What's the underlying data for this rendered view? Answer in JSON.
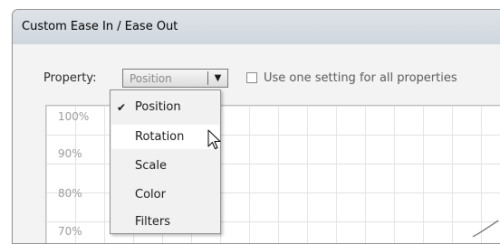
{
  "window": {
    "title": "Custom Ease In / Ease Out"
  },
  "controls": {
    "property_label": "Property:",
    "property_value": "Position",
    "checkbox_label": "Use one setting for all properties"
  },
  "graph": {
    "y_labels": [
      "100%",
      "90%",
      "80%",
      "70%"
    ]
  },
  "dropdown": {
    "items": [
      {
        "label": "Position",
        "checked": true
      },
      {
        "label": "Rotation",
        "checked": false
      },
      {
        "label": "Scale",
        "checked": false
      },
      {
        "label": "Color",
        "checked": false
      },
      {
        "label": "Filters",
        "checked": false
      }
    ],
    "check_glyph": "✔",
    "hovered_item": "Rotation"
  },
  "icons": {
    "select_arrow": "chevron-down-icon",
    "cursor": "arrow-cursor-icon"
  }
}
